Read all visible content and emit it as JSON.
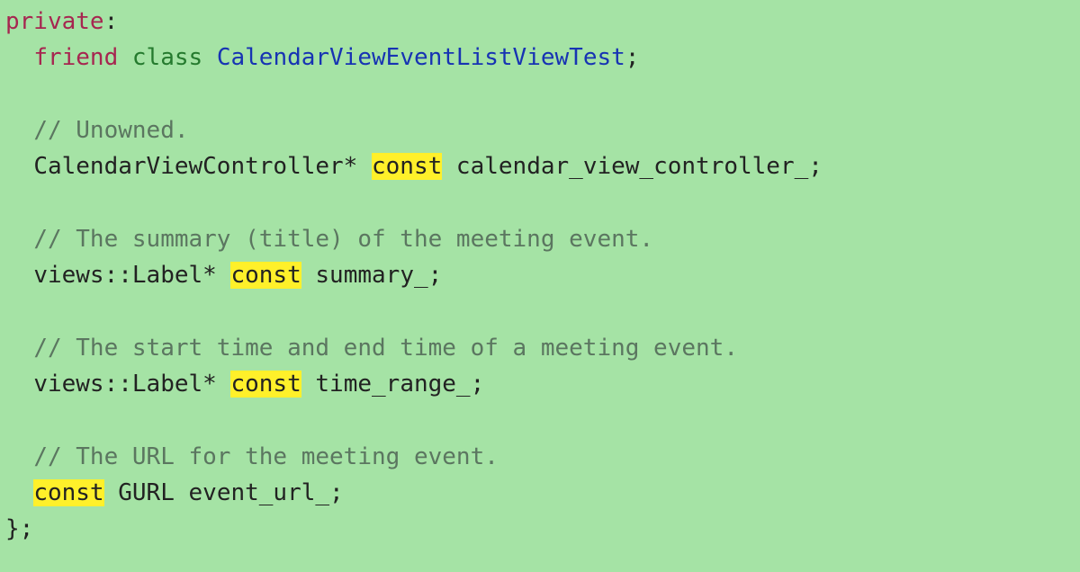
{
  "line1": {
    "private": "private",
    "colon": ":"
  },
  "line2": {
    "indent": "  ",
    "friend": "friend",
    "class": "class",
    "type": "CalendarViewEventListViewTest",
    "semi": ";"
  },
  "line3": {
    "blank": ""
  },
  "line4": {
    "indent": "  ",
    "comment": "// Unowned."
  },
  "line5": {
    "indent": "  ",
    "before": "CalendarViewController* ",
    "const": "const",
    "after": " calendar_view_controller_;"
  },
  "line6": {
    "blank": ""
  },
  "line7": {
    "indent": "  ",
    "comment": "// The summary (title) of the meeting event."
  },
  "line8": {
    "indent": "  ",
    "before": "views::Label* ",
    "const": "const",
    "after": " summary_;"
  },
  "line9": {
    "blank": ""
  },
  "line10": {
    "indent": "  ",
    "comment": "// The start time and end time of a meeting event."
  },
  "line11": {
    "indent": "  ",
    "before": "views::Label* ",
    "const": "const",
    "after": " time_range_;"
  },
  "line12": {
    "blank": ""
  },
  "line13": {
    "indent": "  ",
    "comment": "// The URL for the meeting event."
  },
  "line14": {
    "indent": "  ",
    "const": "const",
    "after": " GURL event_url_;"
  },
  "line15": {
    "close": "};"
  }
}
